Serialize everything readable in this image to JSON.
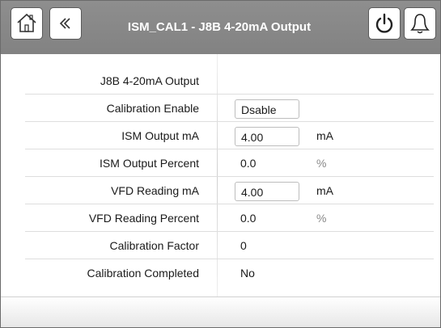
{
  "header": {
    "title": "ISM_CAL1 - J8B 4-20mA Output",
    "home_icon": "home-icon",
    "back_icon": "chevron-left-icon",
    "power_icon": "power-icon",
    "alarm_icon": "bell-icon"
  },
  "colors": {
    "header_bg": "#8a8a8a",
    "unit_mA": "#1a1a1a",
    "unit_percent": "#8a8a8a"
  },
  "rows": [
    {
      "label": "J8B 4-20mA Output",
      "value": "",
      "unit": ""
    },
    {
      "label": "Calibration Enable",
      "value": "Dsable",
      "unit": ""
    },
    {
      "label": "ISM Output mA",
      "value": "4.00",
      "unit": "mA"
    },
    {
      "label": "ISM Output Percent",
      "value": "0.0",
      "unit": "%"
    },
    {
      "label": "VFD Reading mA",
      "value": "4.00",
      "unit": "mA"
    },
    {
      "label": "VFD Reading Percent",
      "value": "0.0",
      "unit": "%"
    },
    {
      "label": "Calibration Factor",
      "value": "0",
      "unit": ""
    },
    {
      "label": "Calibration Completed",
      "value": "No",
      "unit": ""
    }
  ]
}
